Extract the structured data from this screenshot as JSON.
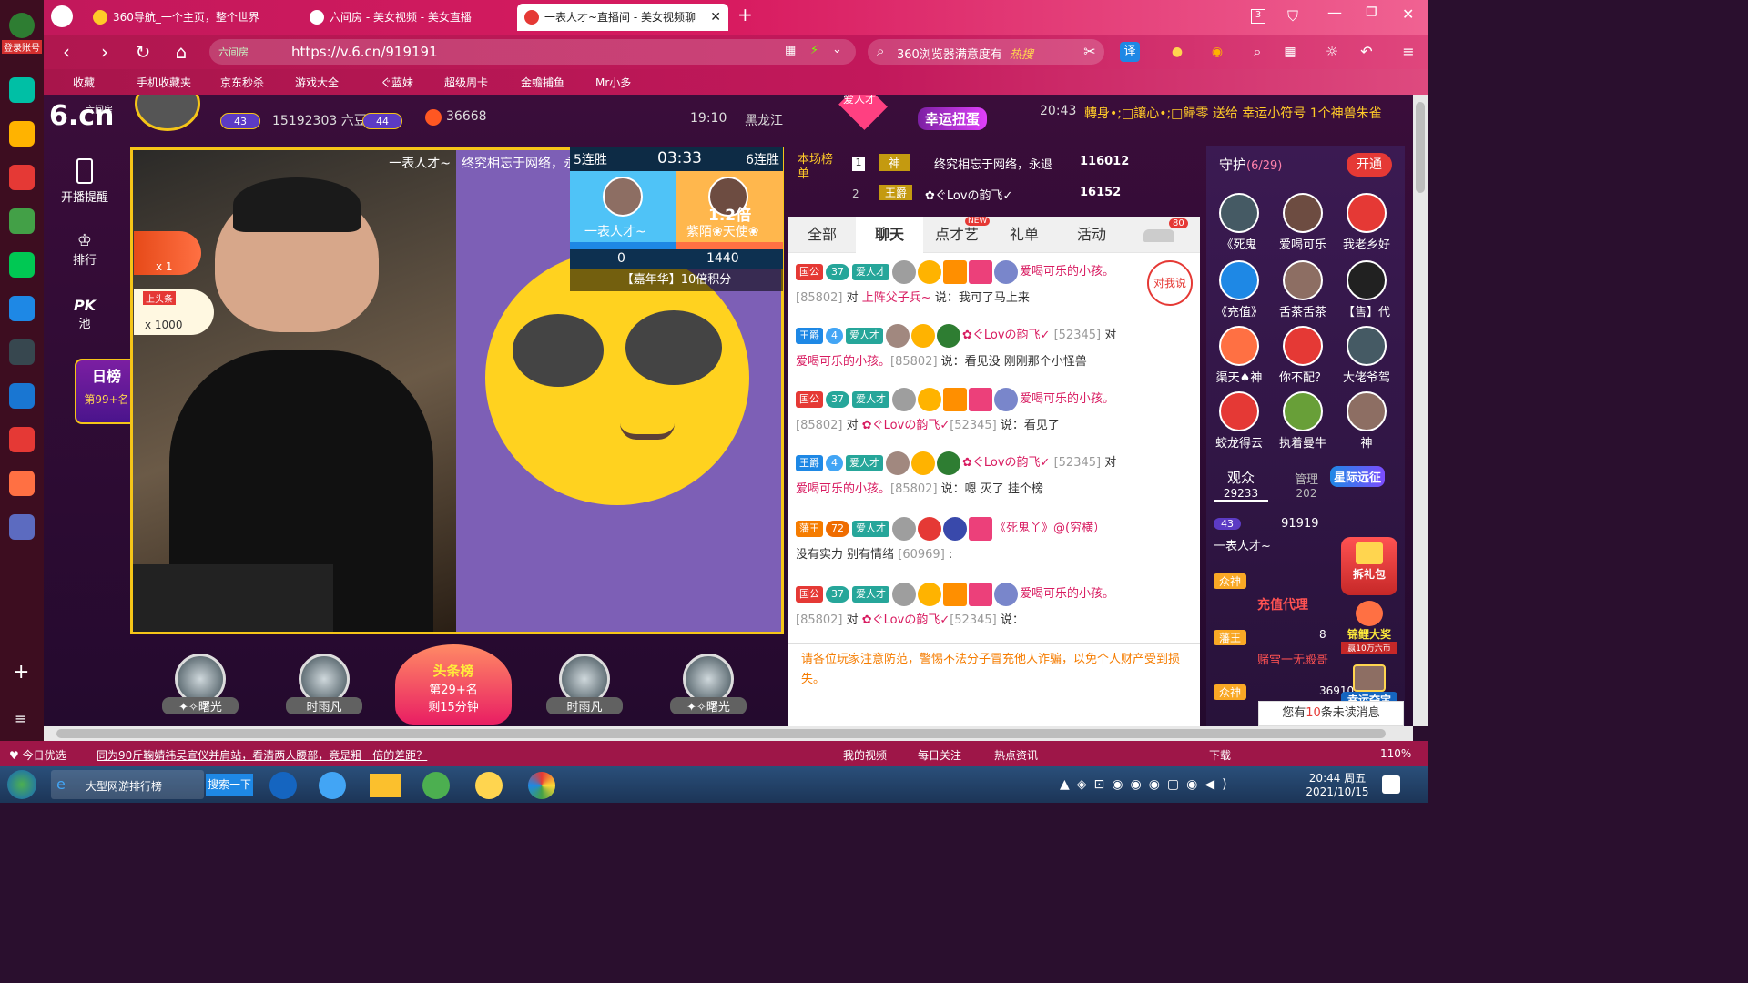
{
  "browser": {
    "tabs": [
      {
        "title": "360导航_一个主页，整个世界",
        "color": "#ffca28"
      },
      {
        "title": "六间房 - 美女视频 - 美女直播",
        "color": "#e53935"
      },
      {
        "title": "一表人才~直播间 - 美女视频聊",
        "color": "#e53935"
      }
    ],
    "new_tab": "+",
    "tab_count": "3",
    "url": "https://v.6.cn/919191",
    "url_verify": "六间房",
    "search_placeholder": "360浏览器满意度有",
    "search_hot": "热搜",
    "translate": "译",
    "login_label": "登录账号",
    "bookmarks": [
      "收藏",
      "手机收藏夹",
      "京东秒杀",
      "游戏大全",
      "ぐ蓝妹",
      "超级周卡",
      "金蟾捕鱼",
      "Mr小多"
    ]
  },
  "header": {
    "logo_text": "6.cn",
    "logo_sub": "六间房",
    "user_level_left": "43",
    "beans": "15192303 六豆",
    "user_level_right": "44",
    "fans": "36668",
    "time": "19:10",
    "location": "黑龙江",
    "gift_label": "幸运扭蛋",
    "gift_label2": "爱人才",
    "marquee_time": "20:43",
    "marquee": "轉身•;□讓心•;□歸零 送给 幸运小符号 1个神兽朱雀"
  },
  "left_column": {
    "broadcast_label": "开播提醒",
    "rank_label": "排行",
    "pk_label": "PK",
    "pk_sub": "池",
    "daily_rank": "日榜",
    "daily_rank_pos": "第99+名"
  },
  "video": {
    "streamer_tag": "一表人才~",
    "ticker": "终究相忘于网络，永",
    "multiplier_1": "x 1",
    "headline_label": "上头条",
    "multiplier_1000": "x 1000",
    "pk": {
      "left_streak": "5连胜",
      "right_streak": "6连胜",
      "timer": "03:33",
      "left_name": "一表人才~",
      "right_name": "紫陌❀天使❀",
      "right_multiplier": "1.2倍",
      "left_score": "0",
      "right_score": "1440",
      "bonus": "【嘉年华】10倍积分"
    }
  },
  "rank_board": {
    "title": "本场榜单",
    "rows": [
      {
        "pos": "1",
        "badge": "神",
        "name": "终究相忘于网络，永退",
        "value": "116012"
      },
      {
        "pos": "2",
        "badge": "王爵",
        "name": "✿ぐLovの韵飞✓",
        "value": "16152"
      }
    ]
  },
  "chat": {
    "tabs": [
      "全部",
      "聊天",
      "点才艺",
      "礼单",
      "活动"
    ],
    "active_tab": "聊天",
    "new_badge": "NEW",
    "car_count": "80",
    "reply_btn": "对我说",
    "messages": [
      {
        "badge": "国公",
        "lvl": "37",
        "nick": "爱人才",
        "user": "爱喝可乐的小孩。",
        "uid": "[85802]",
        "to": "上阵父子兵~",
        "text": "说：我可了马上来"
      },
      {
        "badge": "王爵",
        "lvl": "4",
        "nick": "爱人才",
        "user": "✿ぐLovの韵飞✓",
        "uid": "[52345]",
        "to": "爱喝可乐的小孩。",
        "uid2": "[85802]",
        "text": "说：看见没 刚刚那个小怪兽"
      },
      {
        "badge": "国公",
        "lvl": "37",
        "nick": "爱人才",
        "user": "爱喝可乐的小孩。",
        "uid": "[85802]",
        "to": "✿ぐLovの韵飞✓",
        "uid2": "[52345]",
        "text": "说：看见了"
      },
      {
        "badge": "王爵",
        "lvl": "4",
        "nick": "爱人才",
        "user": "✿ぐLovの韵飞✓",
        "uid": "[52345]",
        "to": "爱喝可乐的小孩。",
        "uid2": "[85802]",
        "text": "说：嗯 灭了 挂个榜"
      },
      {
        "badge": "藩王",
        "lvl": "72",
        "nick": "爱人才",
        "user": "《死鬼丫》@(穷横）",
        "to": "没有实力 别有情绪",
        "uid": "[60969]",
        "text": ":"
      },
      {
        "badge": "国公",
        "lvl": "37",
        "nick": "爱人才",
        "user": "爱喝可乐的小孩。",
        "uid": "[85802]",
        "to": "✿ぐLovの韵飞✓",
        "uid2": "[52345]",
        "text": "说："
      }
    ],
    "system_notice": "请各位玩家注意防范，警惕不法分子冒充他人诈骗，以免个人财产受到损失。",
    "unread_prefix": "您有",
    "unread_count": "10",
    "unread_suffix": "条未读消息"
  },
  "guard_panel": {
    "title": "守护",
    "count": "(6/29)",
    "open_btn": "开通",
    "guards": [
      "《死鬼",
      "爱喝可乐",
      "我老乡好",
      "《充值》",
      "舌茶舌茶",
      "【售】代",
      "渠天♠神",
      "你不配？",
      "大佬爷驾",
      "蛟龙得云",
      "执着曼牛",
      "神"
    ],
    "audience_label": "观众",
    "audience_count": "29233",
    "manage_label": "管理",
    "manage_count": "202",
    "star_expedition": "星际远征",
    "gift_pack": "拆礼包",
    "viewer_lvl": "43",
    "viewer_id": "91919",
    "viewer_name": "一表人才~",
    "koi": "锦鲤大奖",
    "koi_sub": "赢10万六币",
    "agent": "充值代理",
    "gamble": "赌雪一无殿哥",
    "treasure": "幸运夺宝",
    "rank_badge_1": "众神",
    "rank_badge_2": "藩王",
    "rank_badge_3": "众神",
    "viewer_ids": [
      "8",
      "36910"
    ]
  },
  "seats": [
    {
      "name": "✦✧曙光"
    },
    {
      "name": "时雨凡"
    },
    {
      "name": "时雨凡"
    },
    {
      "name": "✦✧曙光"
    }
  ],
  "headline_center": {
    "title": "头条榜",
    "rank": "第29+名",
    "remain": "剩15分钟"
  },
  "statusbar": {
    "today": "今日优选",
    "news": "同为90斤鞠婧祎吴宣仪并肩站，看清两人腰部，竟是粗一倍的差距？",
    "items": [
      "我的视频",
      "每日关注",
      "热点资讯",
      "下载"
    ],
    "zoom": "110%"
  },
  "taskbar": {
    "window_label": "大型网游排行榜",
    "search_label": "搜索一下",
    "time": "20:44 周五",
    "date": "2021/10/15"
  },
  "colors": {
    "accent": "#d81b60",
    "gold": "#f5c518",
    "chat_name": "#d81b60",
    "notice": "#f57c00"
  }
}
